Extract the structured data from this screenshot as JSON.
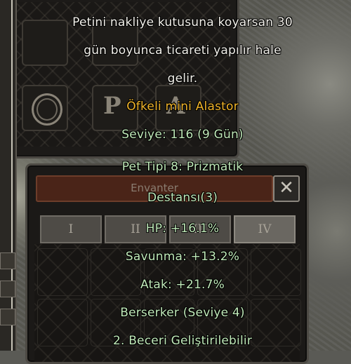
{
  "tooltip": {
    "description": [
      "Petini nakliye kutusuna koyarsan 30",
      "gün boyunca ticareti yapılır hale",
      "gelir."
    ],
    "item_name": "Öfkeli mini Alastor",
    "level": "Seviye: 116 (9 Gün)",
    "pet_type": "Pet Tipi 8: Prizmatik",
    "rank": "Destansı(3)",
    "hp": "HP: +16.1%",
    "defense": "Savunma: +13.2%",
    "attack": "Atak: +21.7%",
    "skill": "Berserker (Seviye 4)",
    "skill2": "2. Beceri Geliştirilebilir"
  },
  "inventory": {
    "title": "Envanter",
    "close_symbol": "✕",
    "tabs": [
      {
        "label": "I"
      },
      {
        "label": "II"
      },
      {
        "label": "III"
      },
      {
        "label": "IV"
      }
    ]
  },
  "pet_window": {
    "slot_letters": [
      "P",
      "A"
    ]
  },
  "colors": {
    "item_name": "#f0b42a",
    "stat_text": "#bfe8b8",
    "description": "#f2f0ea"
  },
  "icons": [
    "close-icon",
    "dragon-emblem-icon"
  ]
}
